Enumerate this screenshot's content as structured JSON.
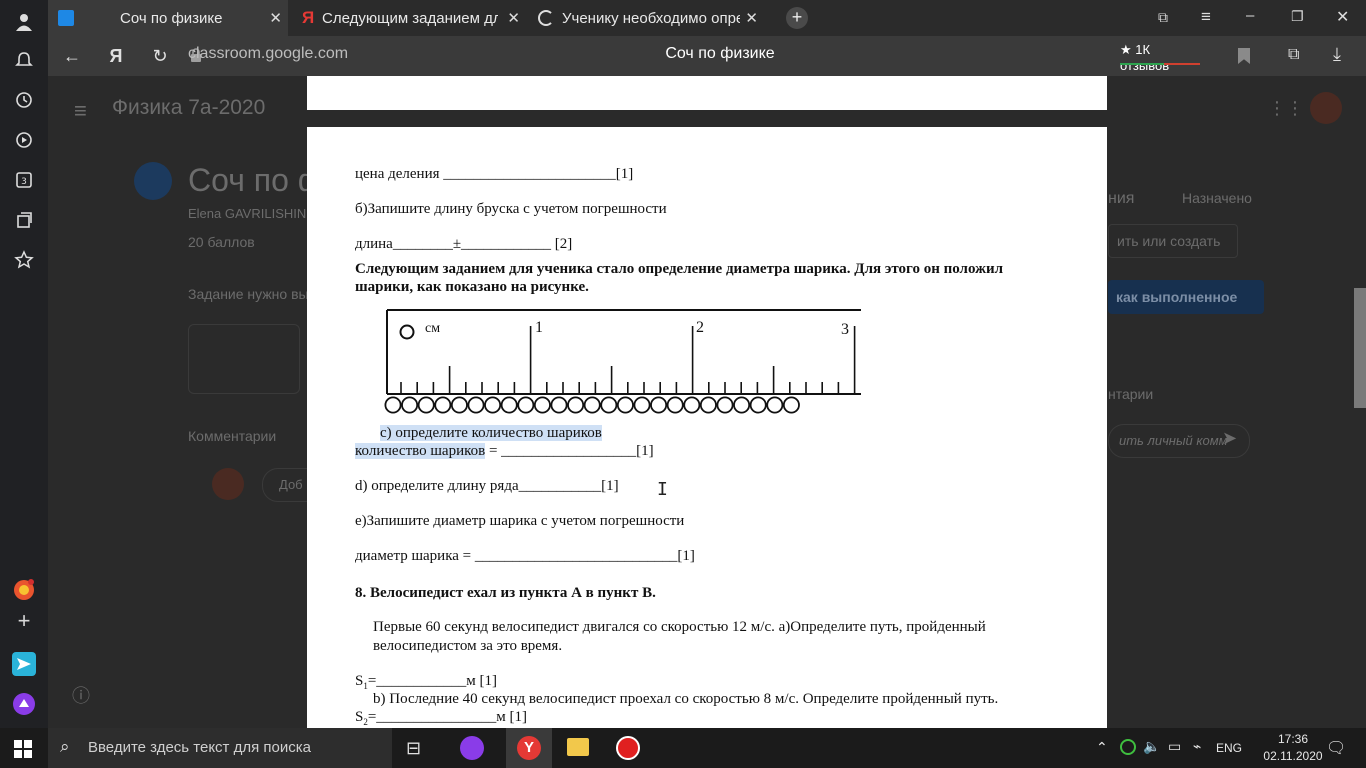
{
  "browser": {
    "tabs": [
      {
        "label": "Соч по физике",
        "active": true
      },
      {
        "label": "Следующим заданием для у"
      },
      {
        "label": "Ученику необходимо опред"
      }
    ],
    "url": "classroom.google.com",
    "page_title": "Соч по физике",
    "reviews": "★ 1К отзывов"
  },
  "classroom": {
    "course": "Физика 7а-2020",
    "assignment_title": "Соч по ф",
    "author": "Elena GAVRILISHIN",
    "points": "20 баллов",
    "note": "Задание нужно вы",
    "comments_label": "Комментарии",
    "comment_placeholder": "Доб",
    "right_header": "ния",
    "status": "Назначено",
    "add_create": "ить или создать",
    "mark_done": "как выполненное",
    "right_comments": "нтарии",
    "private_comment_placeholder": "ить личный комм"
  },
  "document": {
    "l1": "цена деления _______________________[1]",
    "l2": "б)Запишите длину бруска с учетом погрешности",
    "l3": "длина________±____________ [2]",
    "l4": "Следующим заданием для ученика стало определение диаметра шарика. Для этого он положил",
    "l5": "шарики, как показано на рисунке.",
    "figure": {
      "unit": "см",
      "ticks": [
        "1",
        "2",
        "3"
      ],
      "ball_count": 25
    },
    "l6": "с) определите количество шариков",
    "l7a": "количество шариков",
    "l7b": " = __________________[1]",
    "l8": "d) определите длину ряда___________[1]",
    "l9": "е)Запишите диаметр шарика с учетом погрешности",
    "l10": "диаметр шарика = ___________________________[1]",
    "l11": "8. Велосипедист ехал из пункта А в пункт В.",
    "l12": "Первые 60 секунд велосипедист двигался со скоростью 12 м/с. а)Определите путь, пройденный",
    "l13": "велосипедистом за это время.",
    "l14a": "S",
    "l14sub": "1",
    "l14b": "=____________м        [1]",
    "l15": "b) Последние 40 секунд велосипедист проехал со скоростью 8 м/с. Определите пройденный путь.",
    "l16a": "S",
    "l16sub": "2",
    "l16b": "=________________м          [1]"
  },
  "taskbar": {
    "search_placeholder": "Введите здесь текст для поиска",
    "lang": "ENG",
    "time": "17:36",
    "date": "02.11.2020"
  }
}
